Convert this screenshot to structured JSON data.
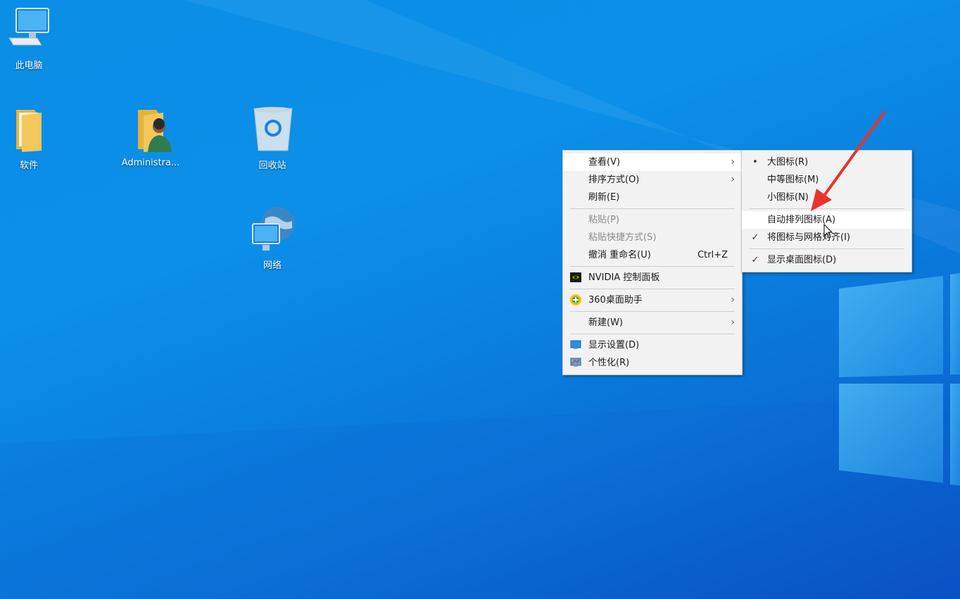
{
  "desktop": {
    "icons": [
      {
        "label": "此电脑",
        "icon": "this-pc-icon"
      },
      {
        "label": "软件",
        "icon": "folder-icon"
      },
      {
        "label": "Administra...",
        "icon": "user-folder-icon"
      },
      {
        "label": "回收站",
        "icon": "recycle-bin-icon"
      },
      {
        "label": "网络",
        "icon": "network-icon"
      }
    ]
  },
  "context_menu": {
    "items": [
      {
        "label": "查看(V)",
        "has_submenu": true
      },
      {
        "label": "排序方式(O)",
        "has_submenu": true
      },
      {
        "label": "刷新(E)"
      },
      {
        "label": "粘贴(P)",
        "disabled": true
      },
      {
        "label": "粘贴快捷方式(S)",
        "disabled": true
      },
      {
        "label": "撤消 重命名(U)",
        "shortcut": "Ctrl+Z"
      },
      {
        "label": "NVIDIA 控制面板",
        "icon": "nvidia-icon"
      },
      {
        "label": "360桌面助手",
        "icon": "360-icon",
        "has_submenu": true
      },
      {
        "label": "新建(W)",
        "has_submenu": true
      },
      {
        "label": "显示设置(D)",
        "icon": "display-settings-icon"
      },
      {
        "label": "个性化(R)",
        "icon": "personalize-icon"
      }
    ]
  },
  "view_submenu": {
    "items": [
      {
        "label": "大图标(R)",
        "mark": "•"
      },
      {
        "label": "中等图标(M)"
      },
      {
        "label": "小图标(N)"
      },
      {
        "label": "自动排列图标(A)",
        "highlighted": true
      },
      {
        "label": "将图标与网格对齐(I)",
        "mark": "✓"
      },
      {
        "label": "显示桌面图标(D)",
        "mark": "✓"
      }
    ]
  },
  "colors": {
    "annotation_arrow": "#e8322e",
    "menu_background": "#f2f2f2"
  }
}
